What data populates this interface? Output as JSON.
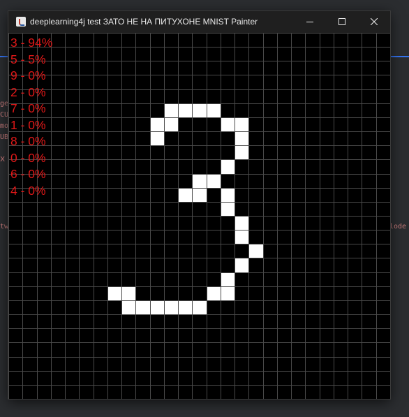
{
  "window": {
    "title": "deeplearning4j test ЗАТО НЕ НА ПИТУХОНЕ MNIST Painter",
    "controls": {
      "minimize_icon": "minimize-icon",
      "maximize_icon": "maximize-icon",
      "close_icon": "close-icon"
    }
  },
  "colors": {
    "titlebar": "#1f1f1f",
    "canvas": "#000000",
    "grid_line": "#4a4a4a",
    "painted_cell": "#ffffff",
    "prediction_text": "#e01818"
  },
  "predictions": [
    {
      "digit": "3",
      "label": "3 - 94%"
    },
    {
      "digit": "5",
      "label": "5 - 5%"
    },
    {
      "digit": "9",
      "label": "9 - 0%"
    },
    {
      "digit": "2",
      "label": "2 - 0%"
    },
    {
      "digit": "7",
      "label": "7 - 0%"
    },
    {
      "digit": "1",
      "label": "1 - 0%"
    },
    {
      "digit": "8",
      "label": "8 - 0%"
    },
    {
      "digit": "0",
      "label": "0 - 0%"
    },
    {
      "digit": "6",
      "label": "6 - 0%"
    },
    {
      "digit": "4",
      "label": "4 - 0%"
    }
  ],
  "painter_grid": {
    "columns": 27,
    "rows": 26,
    "painted_cells": [
      [
        5,
        11
      ],
      [
        5,
        12
      ],
      [
        5,
        13
      ],
      [
        5,
        14
      ],
      [
        6,
        10
      ],
      [
        6,
        11
      ],
      [
        6,
        15
      ],
      [
        6,
        16
      ],
      [
        7,
        10
      ],
      [
        7,
        16
      ],
      [
        8,
        16
      ],
      [
        9,
        15
      ],
      [
        10,
        13
      ],
      [
        10,
        14
      ],
      [
        11,
        12
      ],
      [
        11,
        13
      ],
      [
        11,
        15
      ],
      [
        12,
        15
      ],
      [
        13,
        16
      ],
      [
        14,
        16
      ],
      [
        15,
        17
      ],
      [
        16,
        16
      ],
      [
        17,
        15
      ],
      [
        18,
        7
      ],
      [
        18,
        8
      ],
      [
        18,
        14
      ],
      [
        18,
        15
      ],
      [
        19,
        8
      ],
      [
        19,
        9
      ],
      [
        19,
        10
      ],
      [
        19,
        11
      ],
      [
        19,
        12
      ],
      [
        19,
        13
      ]
    ]
  },
  "background_ide": {
    "fragments": [
      "ge",
      "CU",
      "mo",
      "UB",
      "x",
      "tw",
      "lode"
    ]
  }
}
